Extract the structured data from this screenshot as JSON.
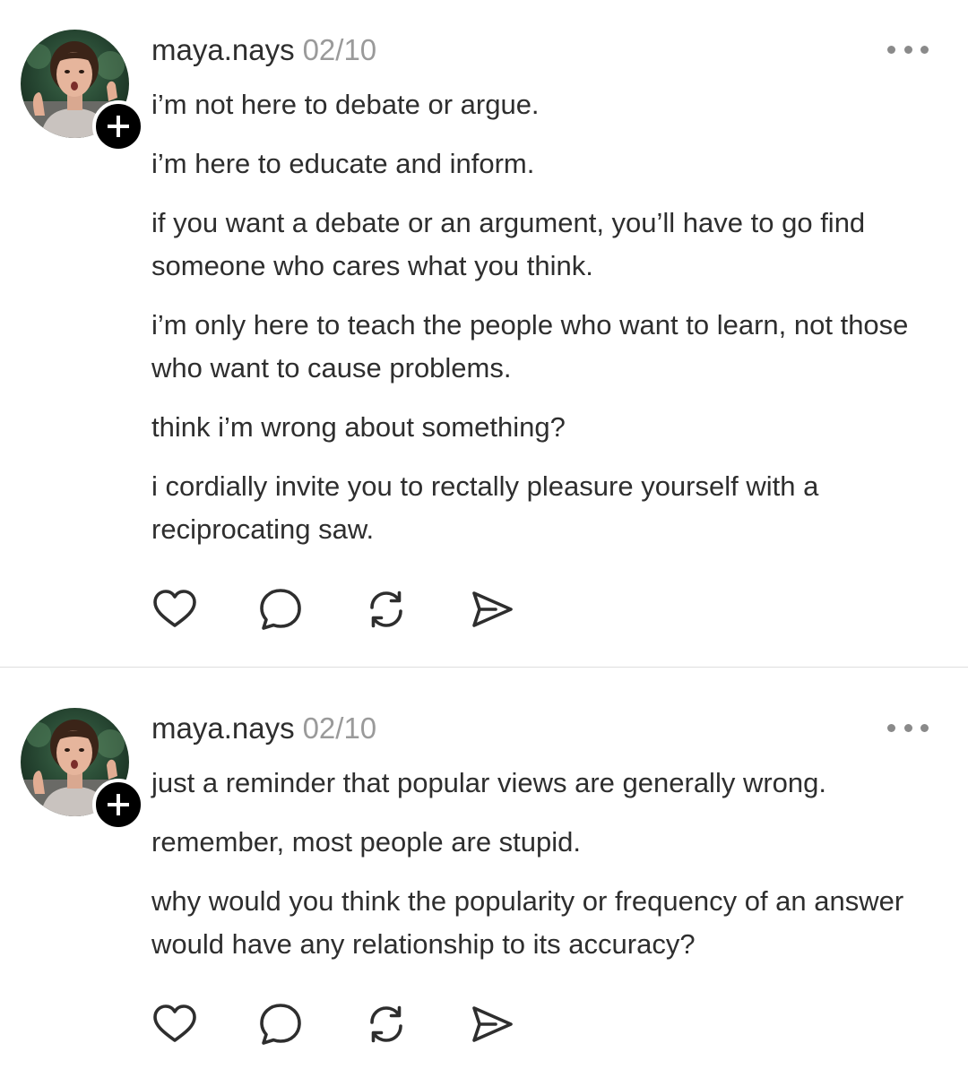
{
  "colors": {
    "text": "#2e2e2e",
    "date": "#9a9a9a",
    "more_dots": "#8a8a8a",
    "divider": "#dedede",
    "follow_badge": "#000000"
  },
  "posts": [
    {
      "username": "maya.nays",
      "date": "02/10",
      "paragraphs": [
        "i’m not here to debate or argue.",
        "i’m here to educate and inform.",
        "if you want a debate or an argument, you’ll have to go find someone who cares what you think.",
        "i’m only here to teach the people who want to learn, not those who want to cause problems.",
        "think i’m wrong about something?",
        "i cordially invite you to rectally pleasure yourself with a reciprocating saw."
      ],
      "actions": [
        "heart-icon",
        "comment-icon",
        "repost-icon",
        "share-icon"
      ]
    },
    {
      "username": "maya.nays",
      "date": "02/10",
      "paragraphs": [
        "just a reminder that popular views are generally wrong.",
        "remember, most people are stupid.",
        "why would you think the popularity or frequency of an answer would have any relationship to its accuracy?"
      ],
      "actions": [
        "heart-icon",
        "comment-icon",
        "repost-icon",
        "share-icon"
      ]
    }
  ]
}
